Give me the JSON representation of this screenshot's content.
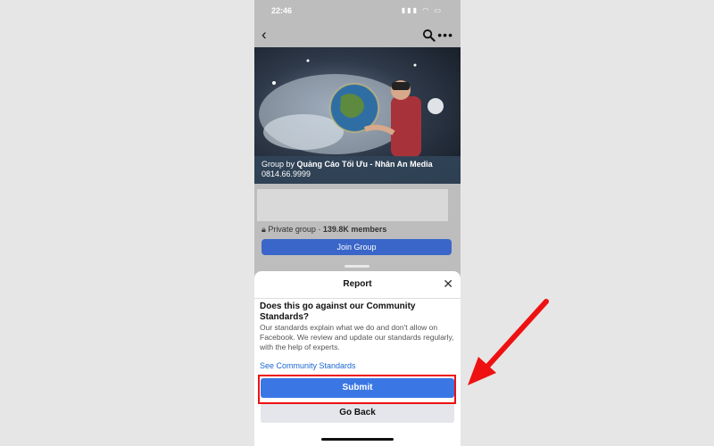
{
  "status_bar": {
    "time": "22:46",
    "icons": [
      "signal-icon",
      "wifi-icon",
      "battery-icon"
    ]
  },
  "nav": {
    "icons": [
      "back-icon",
      "search-icon",
      "more-icon"
    ]
  },
  "cover": {
    "group_by_prefix": "Group by",
    "group_owner": "Quảng Cáo Tối Ưu - Nhân An Media",
    "phone": "0814.66.9999"
  },
  "group_info": {
    "privacy": "Private group ·",
    "members": "139.8K members",
    "join_label": "Join Group"
  },
  "report_sheet": {
    "title": "Report",
    "question": "Does this go against our Community Standards?",
    "description": "Our standards explain what we do and don't allow on Facebook. We review and update our standards regularly, with the help of experts.",
    "link_label": "See Community Standards",
    "submit_label": "Submit",
    "go_back_label": "Go Back"
  },
  "colors": {
    "accent": "#3a76e4",
    "link": "#1b66d2",
    "annotation": "#e11111"
  }
}
